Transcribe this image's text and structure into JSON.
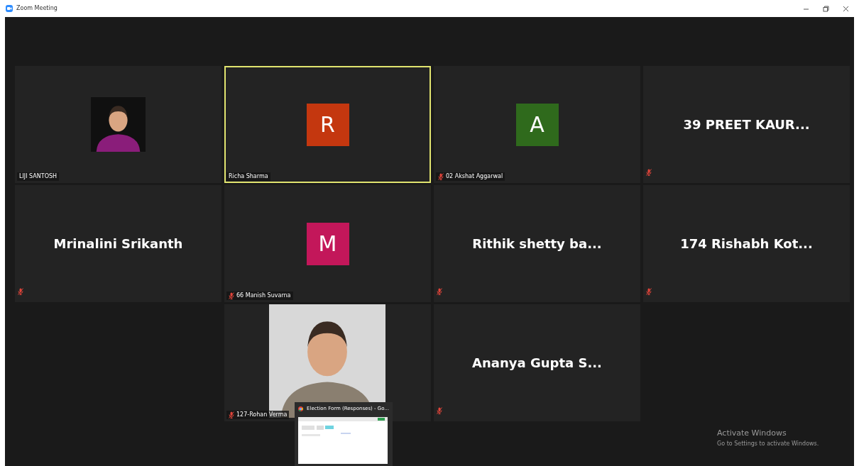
{
  "window": {
    "title": "Zoom Meeting"
  },
  "tiles": [
    {
      "name": "LIJI SANTOSH",
      "muted": false,
      "speaking": false
    },
    {
      "kind": "avatar",
      "letter": "R",
      "color": "#c4370f",
      "name": "Richa Sharma",
      "muted": false,
      "speaking": true
    },
    {
      "kind": "avatar",
      "letter": "A",
      "color": "#2f6a1c",
      "name": "02 Akshat Aggarwal",
      "muted": true,
      "speaking": false
    },
    {
      "kind": "text",
      "title": "39 PREET KAUR...",
      "muted": true,
      "speaking": false
    },
    {
      "kind": "text",
      "title": "Mrinalini Srikanth",
      "muted": true,
      "speaking": false
    },
    {
      "kind": "avatar",
      "letter": "M",
      "color": "#c3175a",
      "name": "66 Manish Suvarna",
      "muted": true,
      "speaking": false
    },
    {
      "kind": "text",
      "title": "Rithik shetty ba...",
      "muted": true,
      "speaking": false
    },
    {
      "kind": "text",
      "title": "174 Rishabh Kot...",
      "muted": true,
      "speaking": false
    },
    {
      "kind": "empty"
    },
    {
      "kind": "video",
      "name": "127-Rohan Verma",
      "muted": true,
      "speaking": false
    },
    {
      "kind": "text",
      "title": "Ananya Gupta S...",
      "muted": true,
      "speaking": false
    },
    {
      "kind": "empty"
    }
  ],
  "preview": {
    "title": "Election Form (Responses) - Go..."
  },
  "watermark": {
    "title": "Activate Windows",
    "subtitle": "Go to Settings to activate Windows."
  }
}
